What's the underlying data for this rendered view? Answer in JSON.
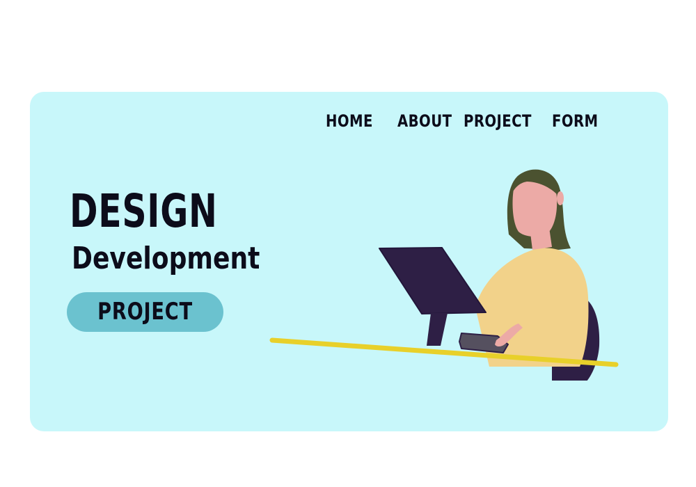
{
  "nav": {
    "items": [
      {
        "label": "HOME"
      },
      {
        "label": "ABOUT"
      },
      {
        "label": "PROJECT"
      },
      {
        "label": "FORM"
      }
    ]
  },
  "hero": {
    "title": "DESIGN",
    "subtitle": "Development",
    "cta_label": "PROJECT"
  },
  "colors": {
    "background": "#ffffff",
    "card": "#c8f7fa",
    "cta": "#6bc2cf",
    "text": "#0c0c1a",
    "monitor": "#2e1f45",
    "sweater": "#f2d28a",
    "skin": "#ecaaa6",
    "hair": "#4b5230",
    "desk": "#e8d02a",
    "keyboard": "#55505f"
  }
}
